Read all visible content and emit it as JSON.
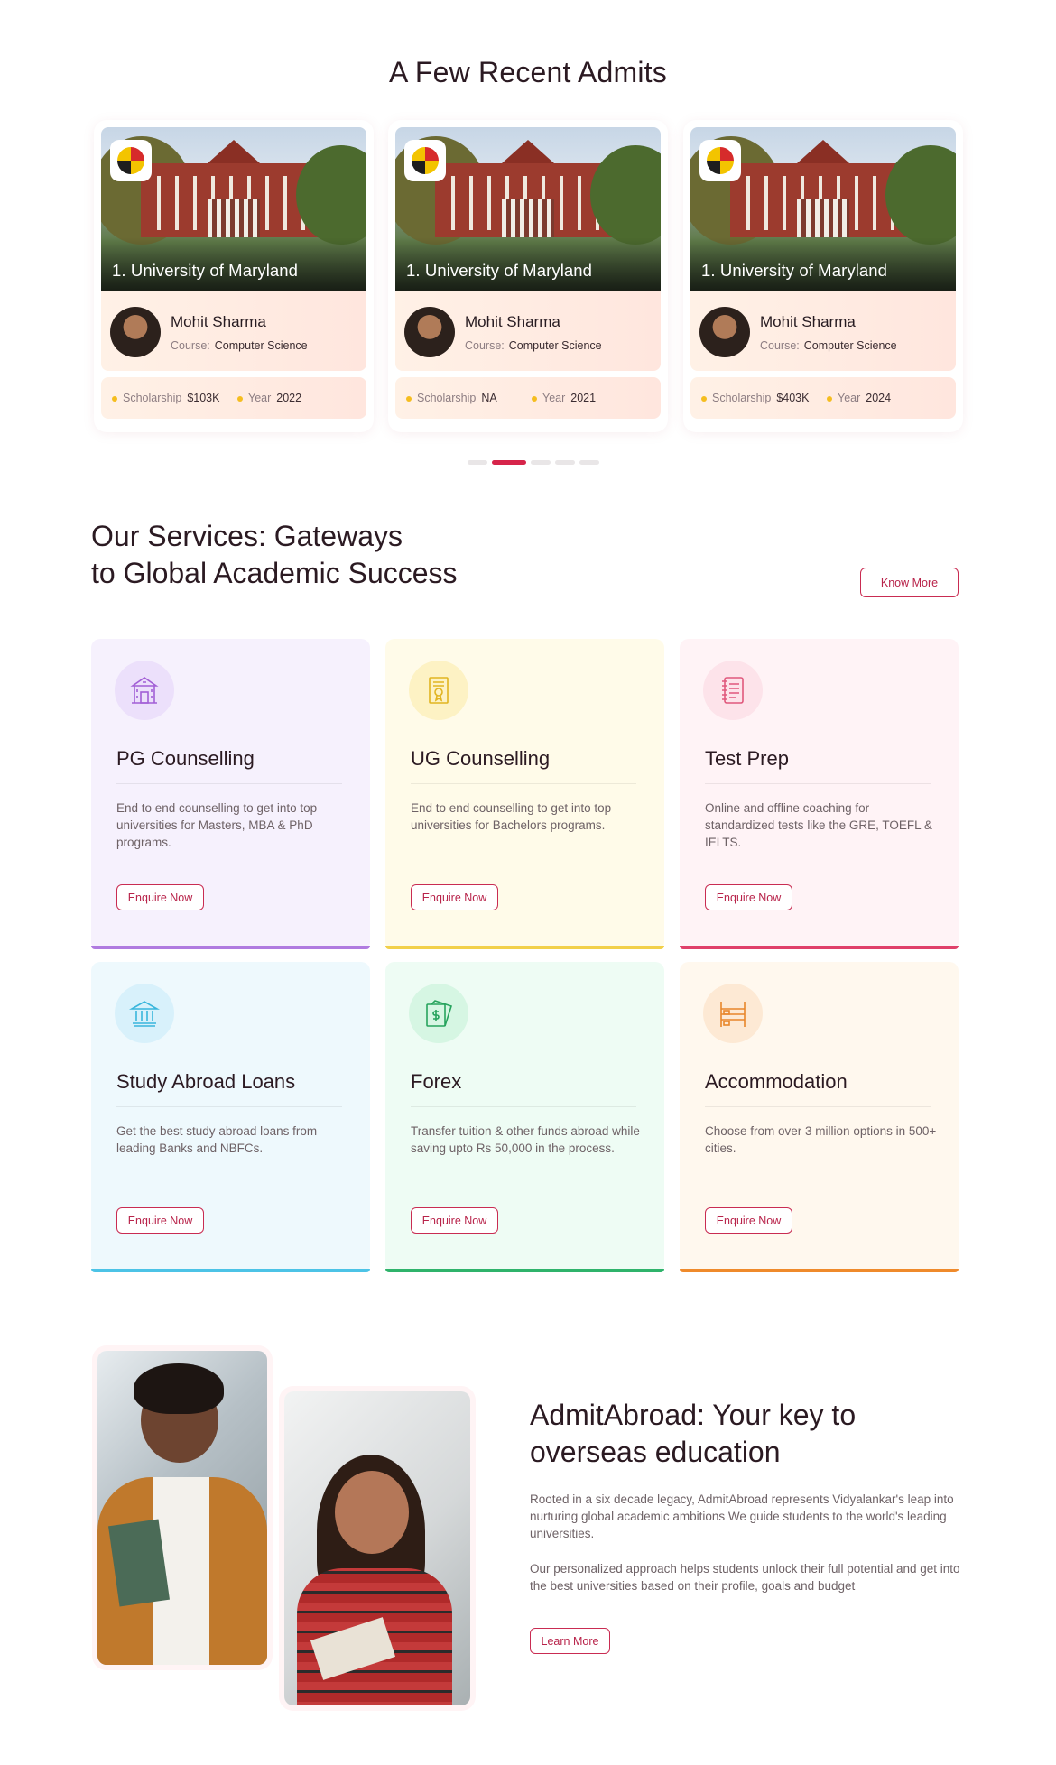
{
  "admits": {
    "title": "A Few Recent Admits",
    "cards": [
      {
        "university": "1. University of Maryland",
        "name": "Mohit Sharma",
        "course_label": "Course:",
        "course": "Computer Science",
        "scholarship_label": "Scholarship",
        "scholarship": "$103K",
        "year_label": "Year",
        "year": "2022"
      },
      {
        "university": "1. University of Maryland",
        "name": "Mohit Sharma",
        "course_label": "Course:",
        "course": "Computer Science",
        "scholarship_label": "Scholarship",
        "scholarship": "NA",
        "year_label": "Year",
        "year": "2021"
      },
      {
        "university": "1. University of Maryland",
        "name": "Mohit Sharma",
        "course_label": "Course:",
        "course": "Computer Science",
        "scholarship_label": "Scholarship",
        "scholarship": "$403K",
        "year_label": "Year",
        "year": "2024"
      }
    ],
    "carousel": {
      "count": 5,
      "active_index": 1
    }
  },
  "services": {
    "title_line1": "Our Services: Gateways",
    "title_line2": "to Global Academic Success",
    "know_more": "Know More",
    "items": [
      {
        "title": "PG Counselling",
        "desc": "End to end counselling to get into top universities for Masters, MBA & PhD programs.",
        "button": "Enquire Now",
        "icon": "university-building-icon",
        "bg": "#f6f1fd",
        "accent": "#b07be0",
        "icon_bg": "#ece0fb",
        "icon_color": "#a25fd6"
      },
      {
        "title": "UG Counselling",
        "desc": "End to end counselling to get into top universities for Bachelors programs.",
        "button": "Enquire Now",
        "icon": "certificate-icon",
        "bg": "#fffbe9",
        "accent": "#f2d04a",
        "icon_bg": "#fdf2c4",
        "icon_color": "#e1b420"
      },
      {
        "title": "Test Prep",
        "desc": "Online and offline coaching for standardized tests like the GRE, TOEFL & IELTS.",
        "button": "Enquire Now",
        "icon": "notebook-icon",
        "bg": "#fff3f6",
        "accent": "#e0406a",
        "icon_bg": "#fde3ea",
        "icon_color": "#e0587c"
      },
      {
        "title": "Study Abroad Loans",
        "desc": "Get the best study abroad loans from leading Banks and NBFCs.",
        "button": "Enquire Now",
        "icon": "bank-icon",
        "bg": "#eef9fd",
        "accent": "#4cc3e6",
        "icon_bg": "#d8f1fb",
        "icon_color": "#39b6dc"
      },
      {
        "title": "Forex",
        "desc": "Transfer tuition & other funds abroad while saving upto Rs 50,000 in the process.",
        "button": "Enquire Now",
        "icon": "money-transfer-icon",
        "bg": "#eefcf4",
        "accent": "#2fb36b",
        "icon_bg": "#d6f6e3",
        "icon_color": "#27a35d"
      },
      {
        "title": "Accommodation",
        "desc": "Choose from over 3 million options in 500+ cities.",
        "button": "Enquire Now",
        "icon": "bunk-bed-icon",
        "bg": "#fff8ee",
        "accent": "#ef8a2b",
        "icon_bg": "#fde9d4",
        "icon_color": "#e8862b"
      }
    ]
  },
  "about": {
    "title_line1": "AdmitAbroad: Your key to",
    "title_line2": "overseas education",
    "para1": "Rooted in a six decade legacy, AdmitAbroad represents Vidyalankar's leap into nurturing global academic ambitions We guide students to the world's leading universities.",
    "para2": "Our personalized approach helps students unlock their full potential and get into the best universities based on their profile, goals and budget",
    "button": "Learn More"
  }
}
